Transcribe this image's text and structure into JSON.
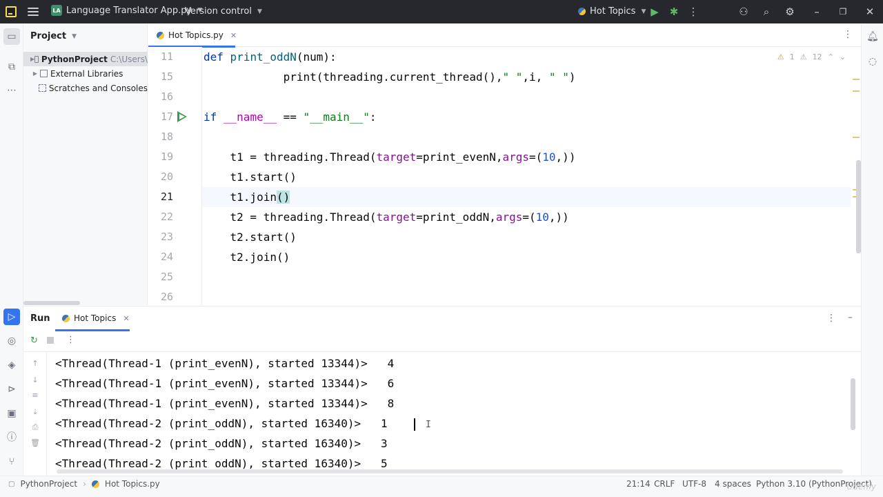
{
  "titlebar": {
    "project_badge": "LA",
    "project_name": "Language Translator App.py",
    "vcs": "Version control",
    "run_config": "Hot Topics",
    "icons": [
      "app-logo-icon",
      "hamburger-menu-icon",
      "run-icon",
      "debug-icon",
      "more-icon",
      "add-user-icon",
      "search-icon",
      "settings-icon",
      "minimize-icon",
      "maximize-icon",
      "close-icon"
    ]
  },
  "project_panel": {
    "title": "Project",
    "items": [
      {
        "label": "PythonProject",
        "path": "C:\\Users\\"
      },
      {
        "label": "External Libraries"
      },
      {
        "label": "Scratches and Consoles"
      }
    ]
  },
  "editor": {
    "tab_label": "Hot Topics.py",
    "warnings": "1",
    "weak_warnings": "12",
    "lines": [
      {
        "num": "11",
        "html": "<span class=\"kw\">def</span> <span class=\"fn\">print_oddN</span>(num):"
      },
      {
        "num": "15",
        "html": "            print(threading.current_thread(),<span class=\"str\">\" \"</span>,i, <span class=\"str\">\" \"</span>)"
      },
      {
        "num": "16",
        "html": ""
      },
      {
        "num": "17",
        "html": "<span class=\"kw\">if</span> <span class=\"dunder\">__name__</span> == <span class=\"str\">\"__main__\"</span>:",
        "run": true
      },
      {
        "num": "18",
        "html": ""
      },
      {
        "num": "19",
        "html": "    t1 = threading.Thread(<span class=\"param\">target</span>=print_evenN,<span class=\"param\">args</span>=(<span class=\"num\">10</span>,))"
      },
      {
        "num": "20",
        "html": "    t1.start()"
      },
      {
        "num": "21",
        "html": "    t1.join<span class=\"hl\">()</span>",
        "current": true
      },
      {
        "num": "22",
        "html": "    t2 = threading.Thread(<span class=\"param\">target</span>=print_oddN,<span class=\"param\">args</span>=(<span class=\"num\">10</span>,))"
      },
      {
        "num": "23",
        "html": "    t2.start()"
      },
      {
        "num": "24",
        "html": "    t2.join()"
      },
      {
        "num": "25",
        "html": ""
      },
      {
        "num": "26",
        "html": ""
      }
    ]
  },
  "run_panel": {
    "title": "Run",
    "tab_label": "Hot Topics",
    "output": [
      "<Thread(Thread-1 (print_evenN), started 13344)>   4",
      "<Thread(Thread-1 (print_evenN), started 13344)>   6",
      "<Thread(Thread-1 (print_evenN), started 13344)>   8",
      "<Thread(Thread-2 (print_oddN), started 16340)>   1",
      "<Thread(Thread-2 (print_oddN), started 16340)>   3",
      "<Thread(Thread-2 (print_oddN), started 16340)>   5"
    ]
  },
  "statusbar": {
    "project": "PythonProject",
    "file": "Hot Topics.py",
    "position": "21:14",
    "line_sep": "CRLF",
    "encoding": "UTF-8",
    "indent": "4 spaces",
    "interpreter": "Python 3.10 (PythonProject)",
    "watermark": "Udemy"
  },
  "colors": {
    "titlebar_bg": "#27282e",
    "accent": "#3574f0",
    "run_green": "#3b9a4e"
  }
}
